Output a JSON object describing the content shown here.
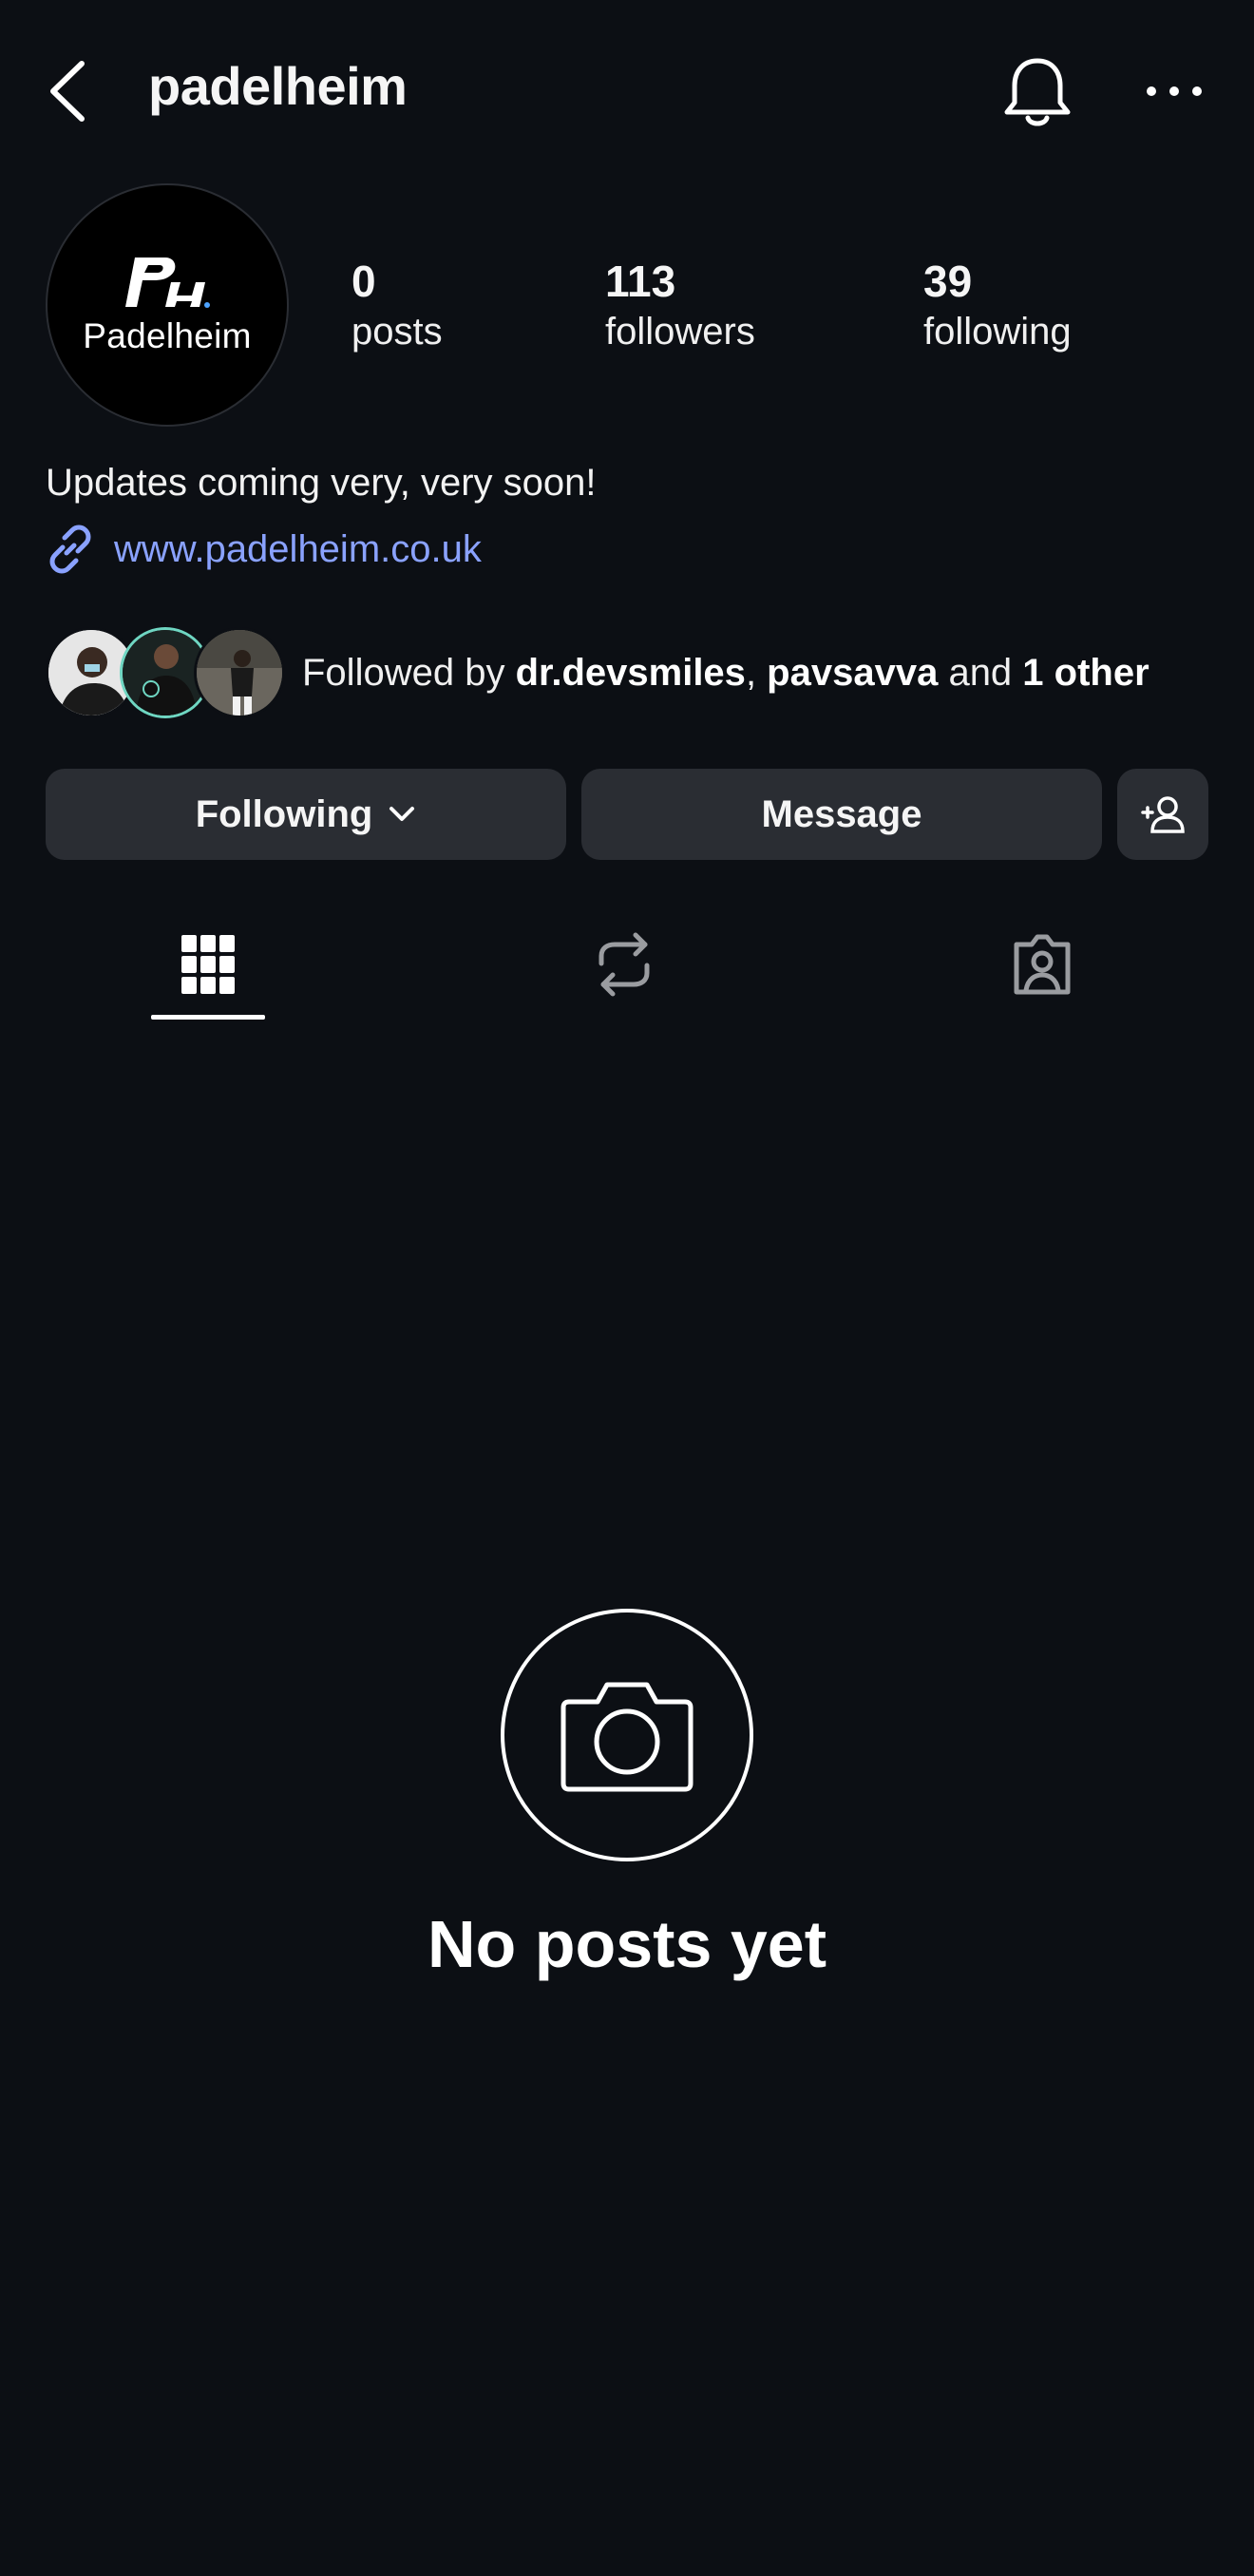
{
  "header": {
    "username": "padelheim"
  },
  "profile": {
    "avatar_text": "Padelheim",
    "avatar_monogram": "PH",
    "stats": {
      "posts": {
        "value": "0",
        "label": "posts"
      },
      "followers": {
        "value": "113",
        "label": "followers"
      },
      "following": {
        "value": "39",
        "label": "following"
      }
    },
    "bio": "Updates coming very, very soon!",
    "link": "www.padelheim.co.uk",
    "followed_by": {
      "prefix": "Followed by ",
      "user1": "dr.devsmiles",
      "sep": ", ",
      "user2": "pavsavva",
      "and": " and ",
      "others": "1 other"
    }
  },
  "actions": {
    "following_label": "Following",
    "message_label": "Message"
  },
  "tabs": [
    "grid-icon",
    "reposts-icon",
    "tagged-icon"
  ],
  "empty_state": {
    "title": "No posts yet"
  },
  "colors": {
    "background": "#0c0f14",
    "button_bg": "#2a2d33",
    "link": "#8aa2ff"
  }
}
